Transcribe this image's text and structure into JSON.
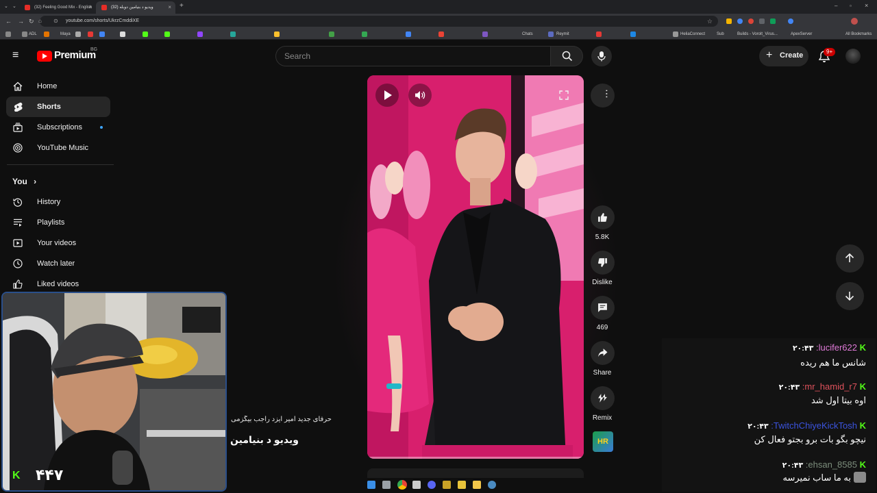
{
  "browser": {
    "tabs": [
      {
        "label": "(32) Feeling Good Mix - English"
      },
      {
        "label": "(32) ویدیو د بنیامین دوبله"
      }
    ],
    "url": "youtube.com/shorts/UkrzCmddiXE",
    "bookmarks": [
      "ADL",
      "Maya",
      "Chats",
      "Reymit",
      "HeliaConnect",
      "Sub",
      "Builds - Vorolt_Virus...",
      "ApexServer",
      "All Bookmarks"
    ]
  },
  "yt": {
    "brand": "Premium",
    "region": "BG",
    "search_placeholder": "Search",
    "create_label": "Create",
    "notif_badge": "9+"
  },
  "sidebar": {
    "items": [
      {
        "label": "Home"
      },
      {
        "label": "Shorts"
      },
      {
        "label": "Subscriptions"
      },
      {
        "label": "YouTube Music"
      }
    ],
    "you_label": "You",
    "you_items": [
      {
        "label": "History"
      },
      {
        "label": "Playlists"
      },
      {
        "label": "Your videos"
      },
      {
        "label": "Watch later"
      },
      {
        "label": "Liked videos"
      }
    ]
  },
  "short": {
    "caption": "حرفای جدید امیر ایزد راجب بیگزمی",
    "channel_title": "ویدیو د بنیامین",
    "likes": "5.8K",
    "dislike_label": "Dislike",
    "comments": "469",
    "share_label": "Share",
    "remix_label": "Remix",
    "channel_badge": "HR"
  },
  "webcam": {
    "viewer_count": "۴۴۷",
    "k_badge": "K"
  },
  "chat": [
    {
      "time": "۲۰:۴۳",
      "user": ":lucifer622",
      "user_color": "#e07ad8",
      "message": "شانس ما هم ریده"
    },
    {
      "time": "۲۰:۴۳",
      "user": ":mr_hamid_r7",
      "user_color": "#e0525c",
      "message": "اوه بیتا اول شد"
    },
    {
      "time": "۲۰:۴۳",
      "user": ":TwitchChiyeKickTosh",
      "user_color": "#3b54e0",
      "message": "نیچو بگو بات برو بجتو فعال کن"
    },
    {
      "time": "۲۰:۴۳",
      "user": ":ehsan_8585",
      "user_color": "#7c8d7c",
      "message": "به ما ساب نمیرسه"
    }
  ],
  "colors": {
    "accent_red": "#ff0000",
    "kick_green": "#53fc18",
    "pink_bg": "#d41c6b"
  }
}
